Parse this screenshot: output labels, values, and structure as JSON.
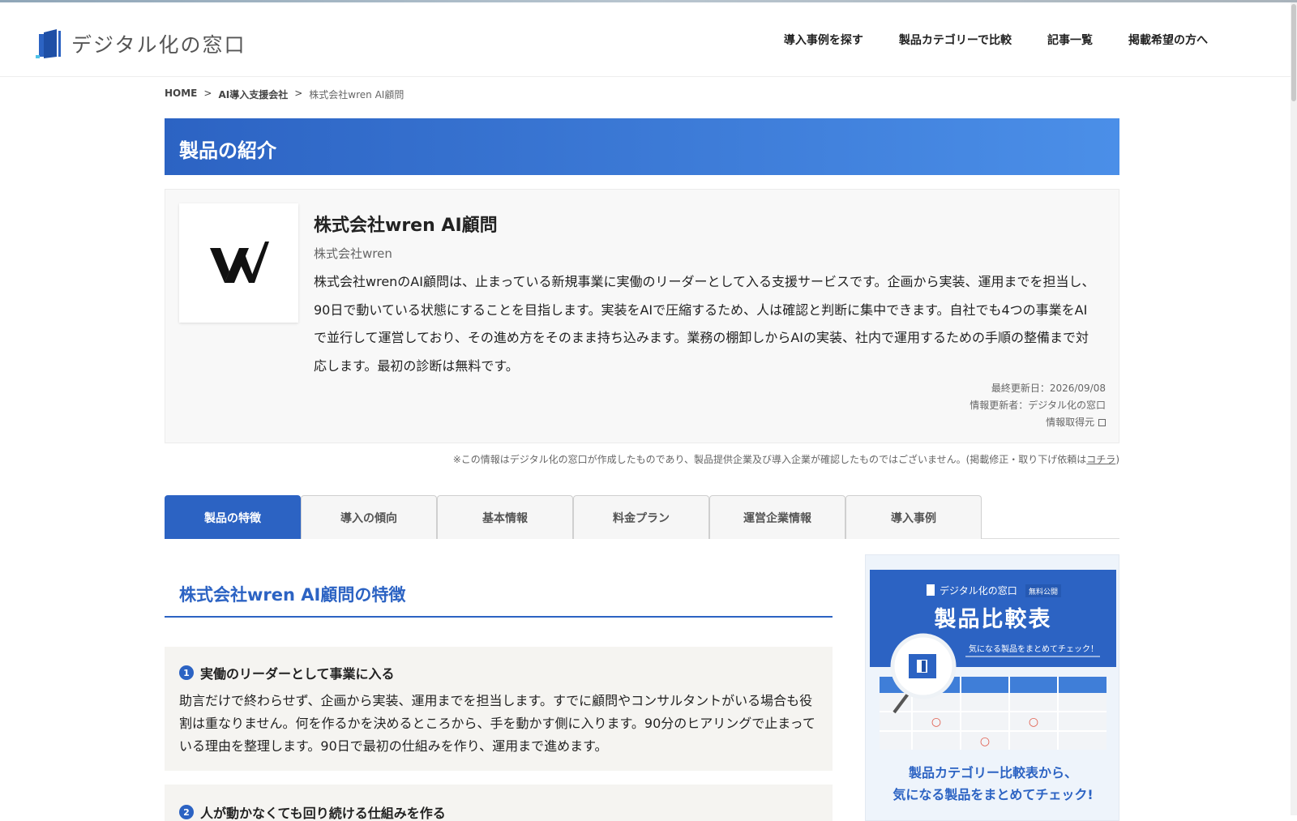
{
  "header": {
    "logo_text": "デジタル化の窓口",
    "nav": [
      "導入事例を探す",
      "製品カテゴリーで比較",
      "記事一覧",
      "掲載希望の方へ"
    ]
  },
  "breadcrumb": {
    "items": [
      "HOME",
      "AI導入支援会社",
      "株式会社wren AI顧問"
    ],
    "separator": ">"
  },
  "banner": {
    "title": "製品の紹介"
  },
  "product": {
    "name": "株式会社wren AI顧問",
    "company": "株式会社wren",
    "description": "株式会社wrenのAI顧問は、止まっている新規事業に実働のリーダーとして入る支援サービスです。企画から実装、運用までを担当し、90日で動いている状態にすることを目指します。実装をAIで圧縮するため、人は確認と判断に集中できます。自社でも4つの事業をAIで並行して運営しており、その進め方をそのまま持ち込みます。業務の棚卸しからAIの実装、社内で運用するための手順の整備まで対応します。最初の診断は無料です。",
    "last_updated": "最終更新日：2026/09/08",
    "updater": "情報更新者：デジタル化の窓口",
    "source_link": "情報取得元"
  },
  "disclaimer": {
    "text": "※この情報はデジタル化の窓口が作成したものであり、製品提供企業及び導入企業が確認したものではございません。(掲載修正・取り下げ依頼は",
    "link": "コチラ",
    "suffix": ")"
  },
  "tabs": [
    "製品の特徴",
    "導入の傾向",
    "基本情報",
    "料金プラン",
    "運営企業情報",
    "導入事例"
  ],
  "active_tab": "製品の特徴",
  "features_section": {
    "title": "株式会社wren AI顧問の特徴",
    "items": [
      {
        "number": "1",
        "title": "実働のリーダーとして事業に入る",
        "body": "助言だけで終わらせず、企画から実装、運用までを担当します。すでに顧問やコンサルタントがいる場合も役割は重なりません。何を作るかを決めるところから、手を動かす側に入ります。90分のヒアリングで止まっている理由を整理します。90日で最初の仕組みを作り、運用まで進めます。"
      },
      {
        "number": "2",
        "title": "人が動かなくても回り続ける仕組みを作る",
        "body": ""
      }
    ]
  },
  "sidebar_ad": {
    "brand": "デジタル化の窓口",
    "badge": "無料公開",
    "title": "製品比較表",
    "ribbon": "気になる製品をまとめてチェック！",
    "marks": [
      "○",
      "○",
      "○"
    ],
    "promo_line1": "製品カテゴリー比較表から、",
    "promo_line2": "気になる製品をまとめてチェック!"
  },
  "colors": {
    "brand_blue": "#2c63c3",
    "banner_gradient_end": "#4b8fe8",
    "feature_bg": "#f5f4f1",
    "card_bg": "#f8f8f8"
  }
}
